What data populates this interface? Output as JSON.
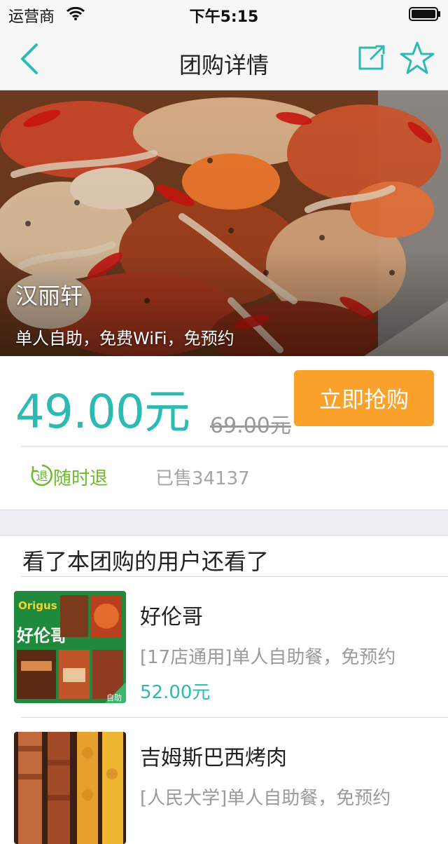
{
  "status_bar": {
    "carrier": "运营商",
    "time": "下午5:15"
  },
  "nav": {
    "title": "团购详情"
  },
  "deal": {
    "name": "汉丽轩",
    "tags": "单人自助，免费WiFi，免预约",
    "price": "49.00元",
    "original_price": "69.00元",
    "buy_label": "立即抢购",
    "refund_label": "随时退",
    "refund_icon_char": "退",
    "sold": "已售34137"
  },
  "recommend": {
    "title": "看了本团购的用户还看了",
    "items": [
      {
        "name": "好伦哥",
        "desc": "[17店通用]单人自助餐，免预约",
        "price": "52.00元",
        "thumb_brand": "Origus",
        "thumb_name": "好伦哥",
        "thumb_badge": "自助"
      },
      {
        "name": "吉姆斯巴西烤肉",
        "desc": "[人民大学]单人自助餐，免预约",
        "price": ""
      }
    ]
  },
  "colors": {
    "accent": "#2cbab2",
    "buy": "#f9a12b",
    "refund": "#6bba2b"
  }
}
